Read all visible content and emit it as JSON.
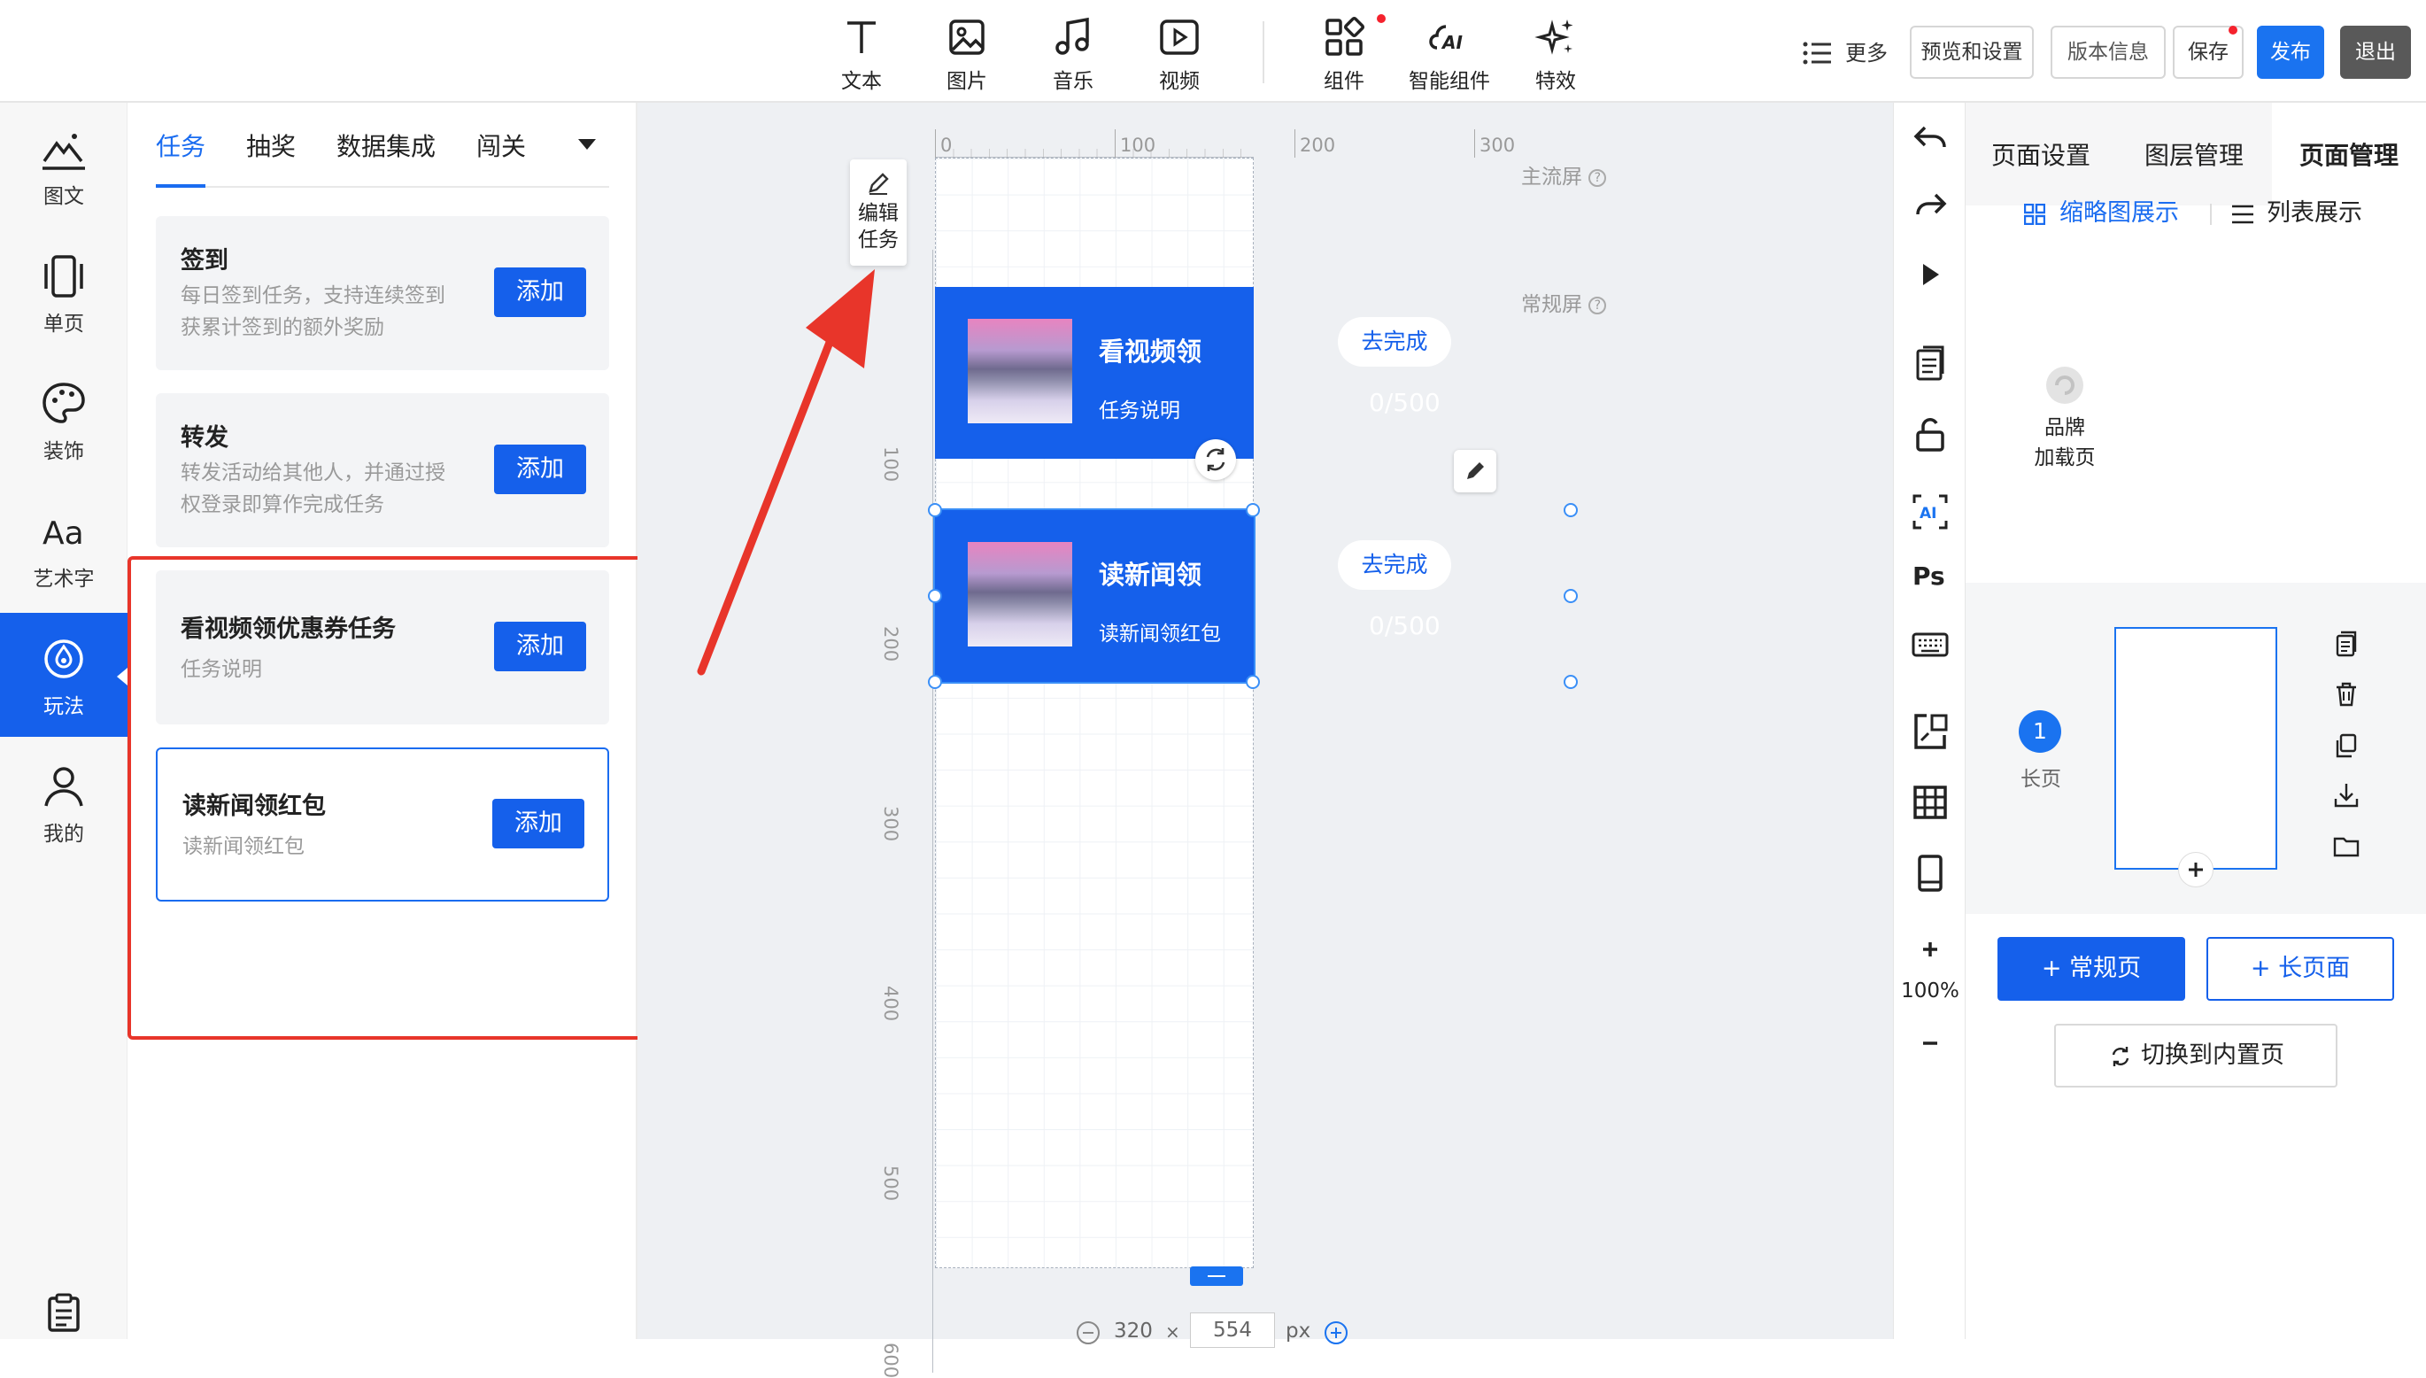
{
  "toolbar": {
    "tools": [
      {
        "label": "文本",
        "icon": "text-icon"
      },
      {
        "label": "图片",
        "icon": "image-icon"
      },
      {
        "label": "音乐",
        "icon": "music-icon"
      },
      {
        "label": "视频",
        "icon": "video-icon"
      },
      {
        "label": "组件",
        "icon": "components-icon"
      },
      {
        "label": "智能组件",
        "icon": "ai-component-icon"
      },
      {
        "label": "特效",
        "icon": "sparkle-icon"
      }
    ],
    "more_label": "更多",
    "preview_label": "预览和设置",
    "version_label": "版本信息",
    "save_label": "保存",
    "publish_label": "发布",
    "exit_label": "退出"
  },
  "rail": {
    "items": [
      {
        "label": "图文",
        "icon": "mountain-icon"
      },
      {
        "label": "单页",
        "icon": "page-icon"
      },
      {
        "label": "装饰",
        "icon": "palette-icon"
      },
      {
        "label": "艺术字",
        "icon": "font-icon"
      },
      {
        "label": "玩法",
        "icon": "gameplay-icon",
        "active": true
      },
      {
        "label": "我的",
        "icon": "user-icon"
      }
    ]
  },
  "panel": {
    "tabs": [
      "任务",
      "抽奖",
      "数据集成",
      "闯关"
    ],
    "active_tab": "任务",
    "cards": [
      {
        "title": "签到",
        "desc": "每日签到任务，支持连续签到获累计签到的额外奖励",
        "add": "添加"
      },
      {
        "title": "转发",
        "desc": "转发活动给其他人，并通过授权登录即算作完成任务",
        "add": "添加"
      },
      {
        "title": "看视频领优惠券任务",
        "desc": "任务说明",
        "add": "添加"
      },
      {
        "title": "读新闻领红包",
        "desc": "读新闻领红包",
        "add": "添加"
      }
    ]
  },
  "canvas": {
    "edit_task_label": "编辑\n任务",
    "ruler_top": [
      "0",
      "100",
      "200",
      "300"
    ],
    "ruler_left": [
      "100",
      "200",
      "300",
      "400",
      "500",
      "600"
    ],
    "main_screen_label": "主流屏",
    "regular_screen_label": "常规屏",
    "tasks": [
      {
        "title": "看视频领",
        "button": "去完成",
        "sub": "任务说明",
        "progress": "0/500"
      },
      {
        "title": "读新闻领",
        "button": "去完成",
        "sub": "读新闻领红包",
        "progress": "0/500"
      }
    ],
    "width_value": "320",
    "height_value": "554",
    "unit": "px",
    "times": "×"
  },
  "rtool": {
    "zoom": "100%"
  },
  "rpanel": {
    "tabs": [
      "页面设置",
      "图层管理",
      "页面管理"
    ],
    "active_tab": "页面管理",
    "view_thumb": "缩略图展示",
    "view_list": "列表展示",
    "brand_label": "品牌\n加载页",
    "page_number": "1",
    "page_label": "长页",
    "add_regular": "+ 常规页",
    "add_long": "+ 长页面",
    "switch_label": "切换到内置页"
  },
  "colors": {
    "accent": "#1560eb",
    "highlight_red": "#e8352a"
  }
}
